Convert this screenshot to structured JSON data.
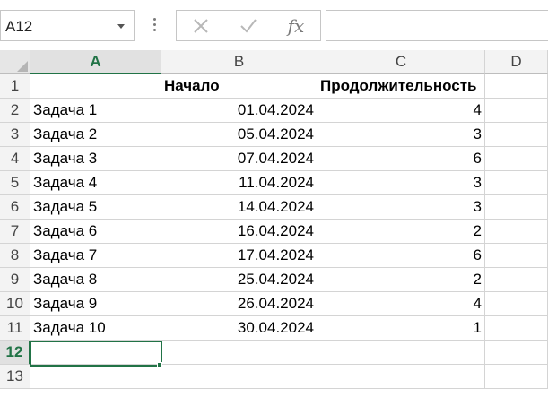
{
  "name_box": {
    "value": "A12"
  },
  "formula_bar": {
    "cancel_icon": "x-icon",
    "enter_icon": "check-icon",
    "function_label": "fx",
    "value": ""
  },
  "colors": {
    "accent": "#217346",
    "header_bg": "#f3f3f3",
    "gridline": "#d4d4d4"
  },
  "columns": [
    "A",
    "B",
    "C",
    "D"
  ],
  "selected_column": "A",
  "rows": [
    {
      "num": "1",
      "a": "",
      "b": "Начало",
      "c": "Продолжительность"
    },
    {
      "num": "2",
      "a": "Задача 1",
      "b": "01.04.2024",
      "c": "4"
    },
    {
      "num": "3",
      "a": "Задача 2",
      "b": "05.04.2024",
      "c": "3"
    },
    {
      "num": "4",
      "a": "Задача 3",
      "b": "07.04.2024",
      "c": "6"
    },
    {
      "num": "5",
      "a": "Задача 4",
      "b": "11.04.2024",
      "c": "3"
    },
    {
      "num": "6",
      "a": "Задача 5",
      "b": "14.04.2024",
      "c": "3"
    },
    {
      "num": "7",
      "a": "Задача 6",
      "b": "16.04.2024",
      "c": "2"
    },
    {
      "num": "8",
      "a": "Задача 7",
      "b": "17.04.2024",
      "c": "6"
    },
    {
      "num": "9",
      "a": "Задача 8",
      "b": "25.04.2024",
      "c": "2"
    },
    {
      "num": "10",
      "a": "Задача 9",
      "b": "26.04.2024",
      "c": "4"
    },
    {
      "num": "11",
      "a": "Задача 10",
      "b": "30.04.2024",
      "c": "1"
    },
    {
      "num": "12",
      "a": "",
      "b": "",
      "c": ""
    },
    {
      "num": "13",
      "a": "",
      "b": "",
      "c": ""
    }
  ],
  "selected_row": "12"
}
